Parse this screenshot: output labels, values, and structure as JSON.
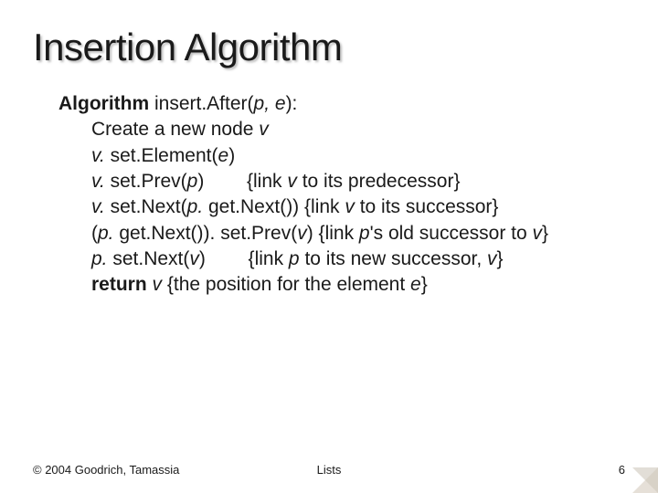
{
  "title": "Insertion Algorithm",
  "algo": {
    "sig_prefix": "Algorithm",
    "sig_mid": " insert.After(",
    "sig_p": "p, e",
    "sig_close": "):",
    "l2a": "Create a new node ",
    "l2v": "v",
    "l3a": "v.",
    "l3b": " set.Element(",
    "l3e": "e",
    "l3c": ")",
    "l4a": "v.",
    "l4b": " set.Prev(",
    "l4p": "p",
    "l4c": ")",
    "l4d": "        {link ",
    "l4v": "v",
    "l4e": " to its predecessor}",
    "l5a": "v.",
    "l5b": " set.Next(",
    "l5p": "p.",
    "l5c": " get.Next())   {link ",
    "l5v": "v",
    "l5d": " to its successor}",
    "l6a": "(",
    "l6p": "p.",
    "l6b": " get.Next()). set.Prev(",
    "l6v": "v",
    "l6c": ") {link ",
    "l6p2": "p",
    "l6d": "'s old successor to ",
    "l6v2": "v",
    "l6e": "}",
    "l7a": "p.",
    "l7b": " set.Next(",
    "l7v": "v",
    "l7c": ")",
    "l7d": "        {link ",
    "l7p": "p",
    "l7e": " to its new successor, ",
    "l7v2": "v",
    "l7f": "}",
    "l8a": "return ",
    "l8v": "v",
    "l8b": "  {the position for the element ",
    "l8e": "e",
    "l8c": "}"
  },
  "footer": {
    "left": "© 2004 Goodrich, Tamassia",
    "center": "Lists",
    "right": "6"
  }
}
